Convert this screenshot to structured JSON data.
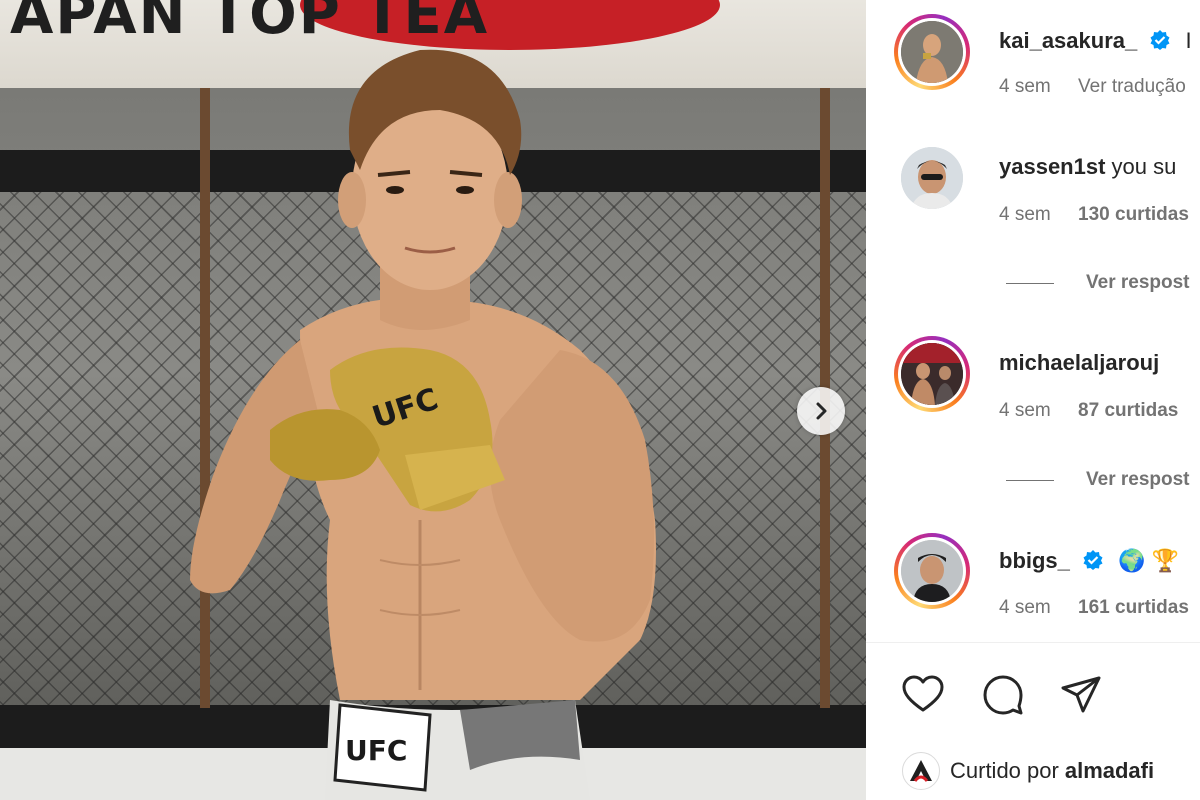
{
  "post": {
    "author": "kai_asakura_",
    "author_caption_start": "I",
    "time": "4 sem",
    "translate_label": "Ver tradução",
    "banner_text": "APAN TOP TEA",
    "glove_brand": "UFC",
    "shorts_brand": "UFC"
  },
  "comments": [
    {
      "username": "yassen1st",
      "text": "you su",
      "time": "4 sem",
      "likes": "130 curtidas",
      "view_replies": "Ver respost"
    },
    {
      "username": "michaelaljarouj",
      "text": "",
      "time": "4 sem",
      "likes": "87 curtidas",
      "view_replies": "Ver respost"
    },
    {
      "username": "bbigs_",
      "text": "🌍 🏆",
      "time": "4 sem",
      "likes": "161 curtidas"
    }
  ],
  "liked_by": {
    "prefix": "Curtido por",
    "name": "almadafi"
  },
  "icons": {
    "verified": "verified-badge-icon",
    "next": "chevron-right-icon",
    "like": "heart-icon",
    "comment": "comment-bubble-icon",
    "share": "paper-plane-icon"
  },
  "colors": {
    "verified_blue": "#0095f6",
    "muted_text": "#737373",
    "story_ring": [
      "#feda75",
      "#fa7e1e",
      "#d62976",
      "#962fbf"
    ]
  }
}
